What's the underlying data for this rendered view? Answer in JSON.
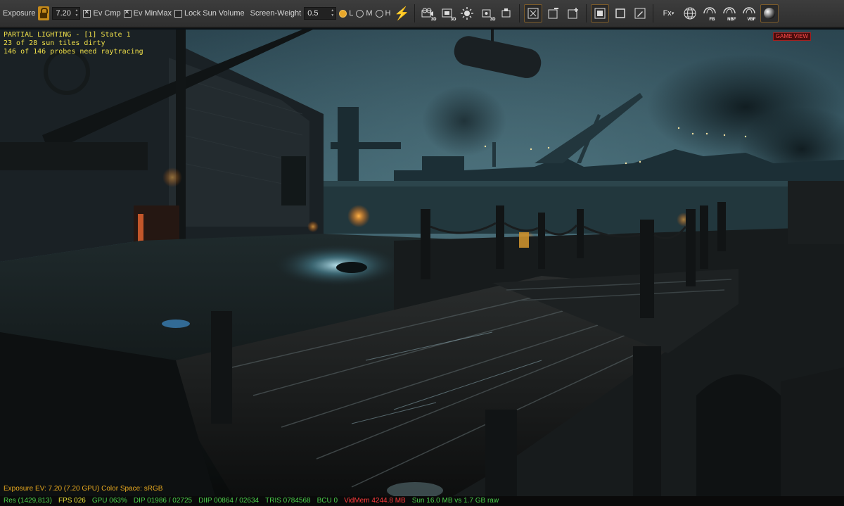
{
  "toolbar": {
    "exposure_label": "Exposure",
    "exposure_value": "7.20",
    "ev_cmp_label": "Ev Cmp",
    "ev_minmax_label": "Ev MinMax",
    "lock_sun_label": "Lock Sun Volume",
    "screen_weight_label": "Screen-Weight",
    "screen_weight_value": "0.5",
    "quality_options": [
      "L",
      "M",
      "H"
    ],
    "quality_selected": "L",
    "fx_label": "Fx",
    "icon_labels": {
      "tool_3d_a": "3D",
      "tool_3d_b": "3D",
      "tool_3d_c": "3D",
      "fb": "FB",
      "nbf": "NBF",
      "vbf": "VBF"
    },
    "accent_color": "#e8a72a"
  },
  "viewport": {
    "lighting_lines": [
      "PARTIAL LIGHTING - [1] State 1",
      "23 of 28 sun tiles dirty",
      "146 of 146 probes need raytracing"
    ],
    "game_view_badge": "GAME VIEW",
    "exposure_info": "Exposure EV: 7.20 (7.20 GPU)  Color Space: sRGB"
  },
  "stats": [
    {
      "text": "Res (1429,813)",
      "color": "#4bd04b"
    },
    {
      "text": "FPS 026",
      "color": "#e8e23a"
    },
    {
      "text": "GPU 063%",
      "color": "#4bd04b"
    },
    {
      "text": "DIP 01986 / 02725",
      "color": "#4bd04b"
    },
    {
      "text": "DIIP 00864 / 02634",
      "color": "#4bd04b"
    },
    {
      "text": "TRIS 0784568",
      "color": "#4bd04b"
    },
    {
      "text": "BCU 0",
      "color": "#4bd04b"
    },
    {
      "text": "VidMem 4244.8 MB",
      "color": "#ff3b3b"
    },
    {
      "text": "Sun 16.0 MB vs 1.7 GB raw",
      "color": "#4bd04b"
    }
  ]
}
